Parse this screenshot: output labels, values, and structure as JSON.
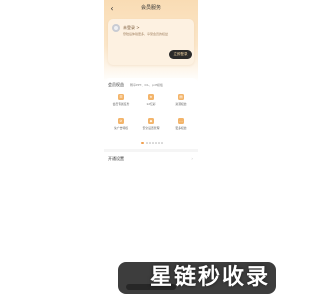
{
  "nav": {
    "title": "会员服务",
    "back_icon": "back-arrow-icon"
  },
  "user_card": {
    "status": "未登录 >",
    "hint": "登陆后体验更多，享受会员的权益",
    "login_button": "立即登录"
  },
  "rights": {
    "title": "会员权益",
    "subtitle": "畅享PPT、ICL、pdf模板",
    "items": [
      {
        "label": "会员专属任务",
        "icon": "task-icon"
      },
      {
        "label": "12亿彩",
        "icon": "lottery-icon"
      },
      {
        "label": "资源权益",
        "icon": "resource-icon"
      },
      {
        "label": "免广告特权",
        "icon": "no-ads-icon"
      },
      {
        "label": "安全设置管理",
        "icon": "security-icon"
      },
      {
        "label": "更多权益",
        "icon": "more-icon"
      }
    ]
  },
  "pager": {
    "count": 7,
    "active": 0
  },
  "settings": {
    "label": "开通设置",
    "chevron": "›"
  },
  "watermark": {
    "text": "星链秒收录"
  },
  "colors": {
    "accent": "#f0a050",
    "card_bg": "#fdf1e1",
    "button_bg": "#2b2b2b",
    "button_text": "#f5d9a8"
  }
}
